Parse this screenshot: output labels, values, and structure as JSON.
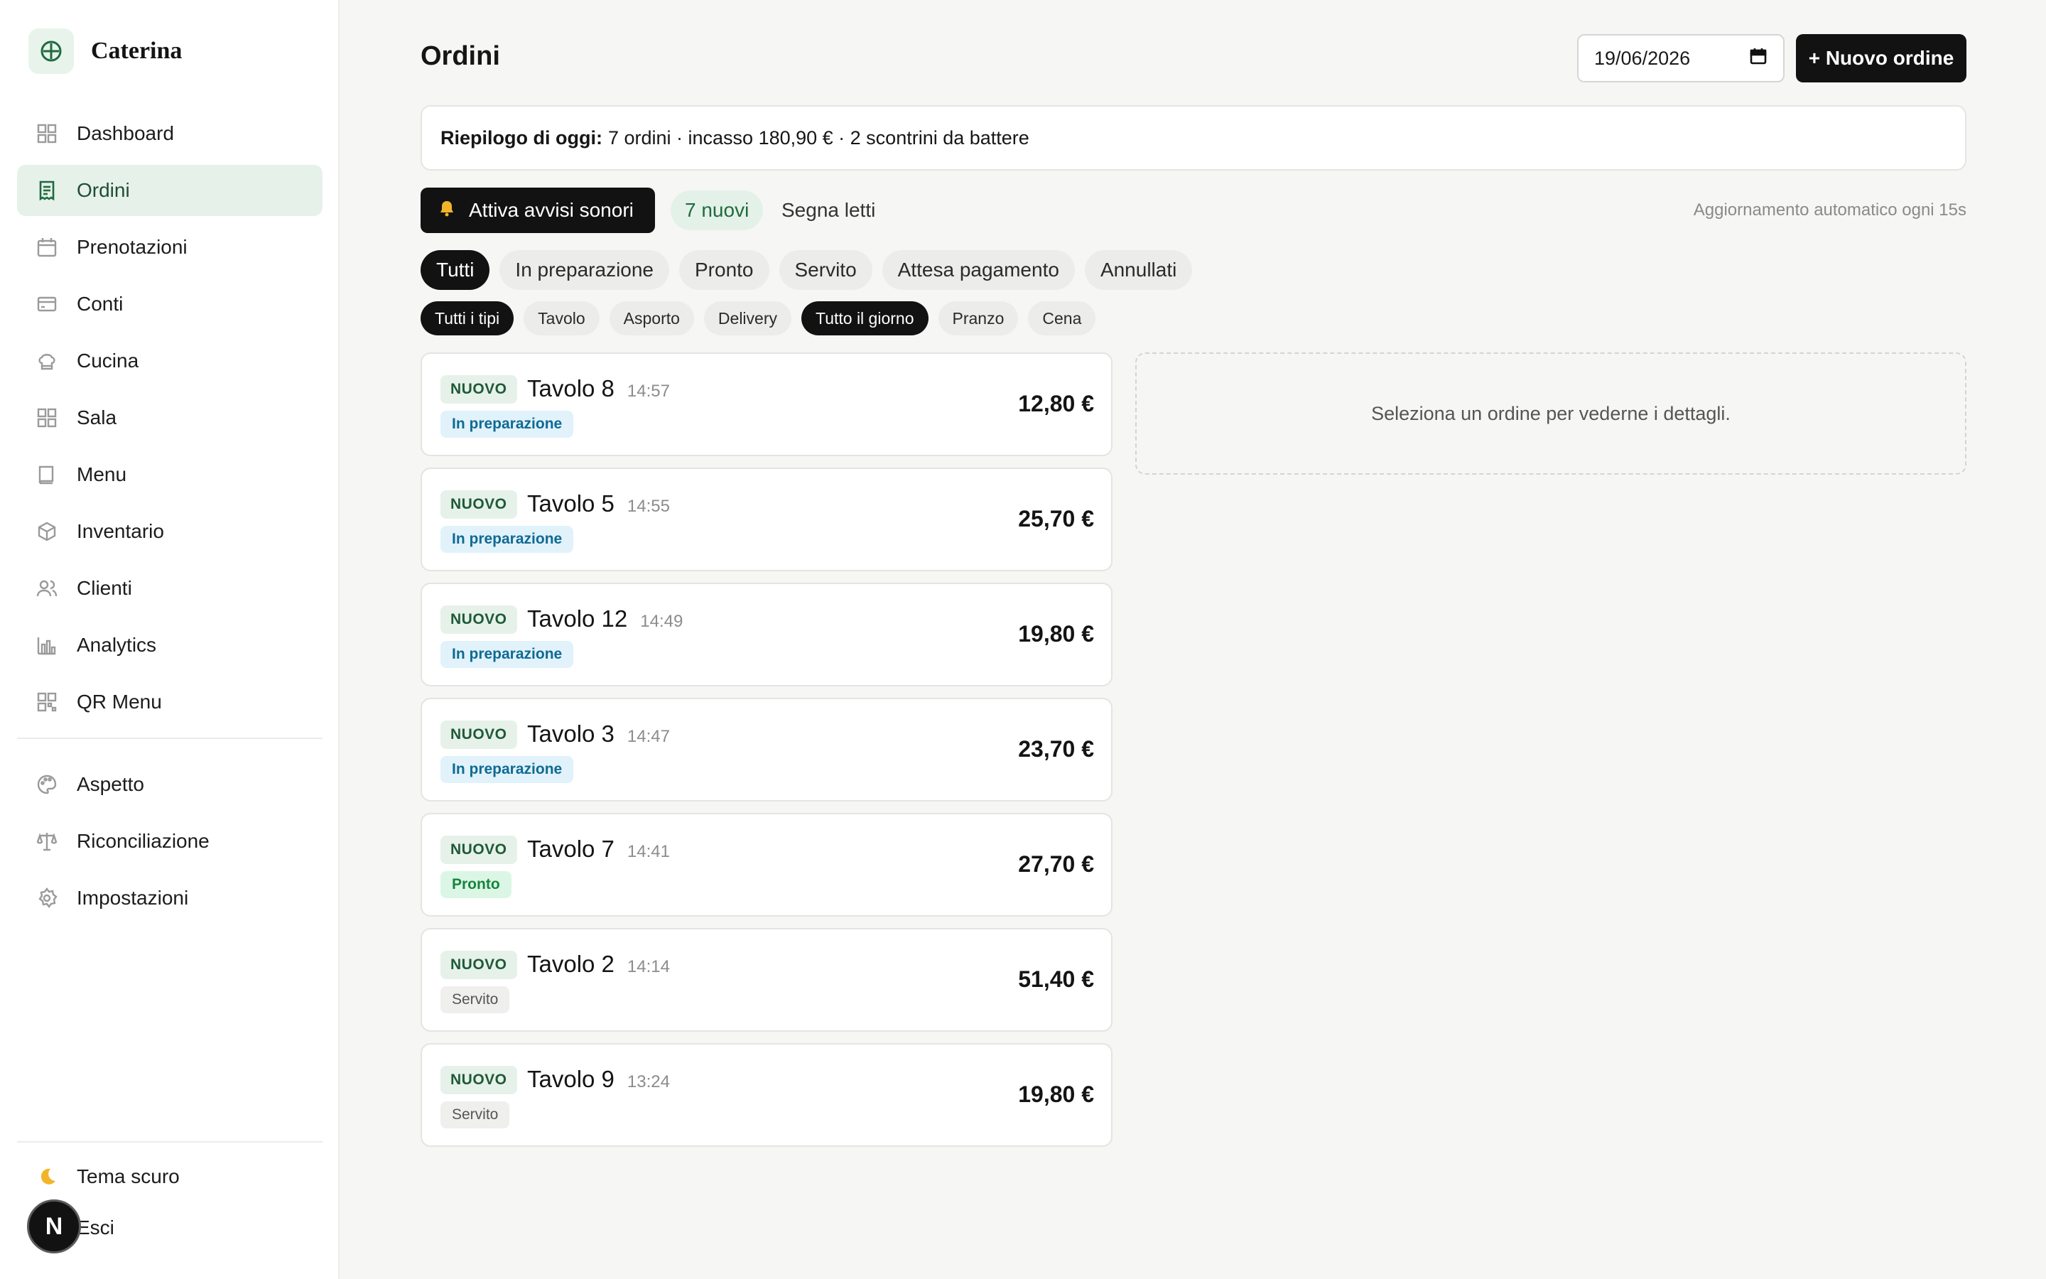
{
  "brand": {
    "name": "Caterina"
  },
  "nav": {
    "items": [
      {
        "label": "Dashboard",
        "icon": "grid-icon"
      },
      {
        "label": "Ordini",
        "icon": "receipt-icon",
        "active": true
      },
      {
        "label": "Prenotazioni",
        "icon": "calendar-icon"
      },
      {
        "label": "Conti",
        "icon": "card-icon"
      },
      {
        "label": "Cucina",
        "icon": "chef-hat-icon"
      },
      {
        "label": "Sala",
        "icon": "grid-icon"
      },
      {
        "label": "Menu",
        "icon": "book-icon"
      },
      {
        "label": "Inventario",
        "icon": "box-icon"
      },
      {
        "label": "Clienti",
        "icon": "users-icon"
      },
      {
        "label": "Analytics",
        "icon": "bar-chart-icon"
      },
      {
        "label": "QR Menu",
        "icon": "qr-icon"
      }
    ],
    "secondary": [
      {
        "label": "Aspetto",
        "icon": "palette-icon"
      },
      {
        "label": "Riconciliazione",
        "icon": "scale-icon"
      },
      {
        "label": "Impostazioni",
        "icon": "gear-icon"
      }
    ],
    "bottom": [
      {
        "label": "Tema scuro",
        "icon": "moon-icon"
      },
      {
        "label": "Esci",
        "icon": "logout-icon"
      }
    ],
    "badge": "N"
  },
  "header": {
    "title": "Ordini",
    "date_value": "19/06/2026",
    "new_order_label": "+ Nuovo ordine"
  },
  "summary": {
    "label": "Riepilogo di oggi:",
    "text": "7 ordini · incasso 180,90 € · 2 scontrini da battere"
  },
  "alerts": {
    "sound_label": "Attiva avvisi sonori",
    "new_count": "7 nuovi",
    "mark_read": "Segna letti",
    "auto_refresh": "Aggiornamento automatico ogni 15s"
  },
  "status_tabs": [
    "Tutti",
    "In preparazione",
    "Pronto",
    "Servito",
    "Attesa pagamento",
    "Annullati"
  ],
  "type_tabs": [
    "Tutti i tipi",
    "Tavolo",
    "Asporto",
    "Delivery"
  ],
  "time_tabs": [
    "Tutto il giorno",
    "Pranzo",
    "Cena"
  ],
  "orders": [
    {
      "badge": "NUOVO",
      "title": "Tavolo 8",
      "time": "14:57",
      "status": "In preparazione",
      "status_kind": "prep",
      "total": "12,80 €"
    },
    {
      "badge": "NUOVO",
      "title": "Tavolo 5",
      "time": "14:55",
      "status": "In preparazione",
      "status_kind": "prep",
      "total": "25,70 €"
    },
    {
      "badge": "NUOVO",
      "title": "Tavolo 12",
      "time": "14:49",
      "status": "In preparazione",
      "status_kind": "prep",
      "total": "19,80 €"
    },
    {
      "badge": "NUOVO",
      "title": "Tavolo 3",
      "time": "14:47",
      "status": "In preparazione",
      "status_kind": "prep",
      "total": "23,70 €"
    },
    {
      "badge": "NUOVO",
      "title": "Tavolo 7",
      "time": "14:41",
      "status": "Pronto",
      "status_kind": "ready",
      "total": "27,70 €"
    },
    {
      "badge": "NUOVO",
      "title": "Tavolo 2",
      "time": "14:14",
      "status": "Servito",
      "status_kind": "served",
      "total": "51,40 €"
    },
    {
      "badge": "NUOVO",
      "title": "Tavolo 9",
      "time": "13:24",
      "status": "Servito",
      "status_kind": "served",
      "total": "19,80 €"
    }
  ],
  "detail": {
    "placeholder": "Seleziona un ordine per vederne i dettagli."
  },
  "colors": {
    "accent": "#1f6b3e",
    "accent_bg": "#e6f1ea",
    "primary": "#121212"
  }
}
